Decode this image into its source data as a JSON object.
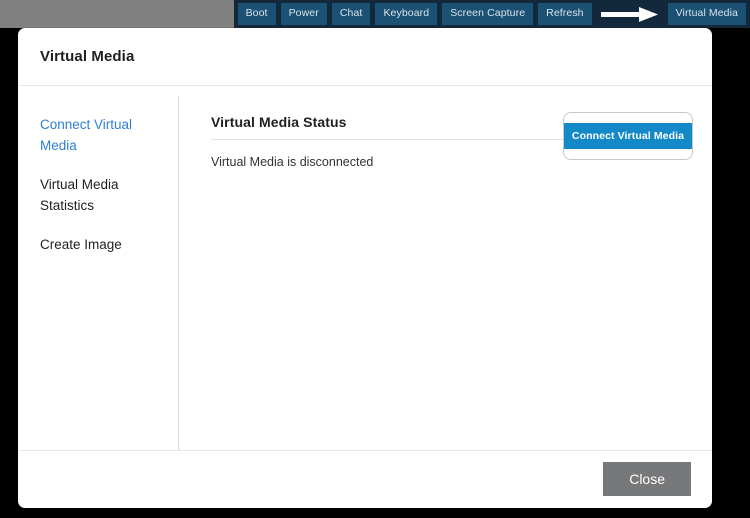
{
  "toolbar": {
    "buttons": [
      {
        "label": "Boot",
        "name": "toolbar-boot-button"
      },
      {
        "label": "Power",
        "name": "toolbar-power-button"
      },
      {
        "label": "Chat",
        "name": "toolbar-chat-button"
      },
      {
        "label": "Keyboard",
        "name": "toolbar-keyboard-button"
      },
      {
        "label": "Screen Capture",
        "name": "toolbar-screen-capture-button"
      },
      {
        "label": "Refresh",
        "name": "toolbar-refresh-button"
      }
    ],
    "virtual_media_label": "Virtual Media",
    "annotation_icon": "right-arrow-icon"
  },
  "dialog": {
    "title": "Virtual Media",
    "nav": [
      {
        "label": "Connect Virtual Media",
        "active": true
      },
      {
        "label": "Virtual Media Statistics",
        "active": false
      },
      {
        "label": "Create Image",
        "active": false
      }
    ],
    "section_title": "Virtual Media Status",
    "status_text": "Virtual Media is disconnected",
    "connect_button_label": "Connect Virtual Media",
    "close_button_label": "Close"
  },
  "colors": {
    "toolbar_background": "#14283c",
    "toolbar_button": "#1b5273",
    "overlay_gray": "#808080",
    "accent_blue": "#1389c8",
    "link_blue": "#2d7fd3",
    "close_gray": "#77787a",
    "backdrop": "#000000"
  }
}
